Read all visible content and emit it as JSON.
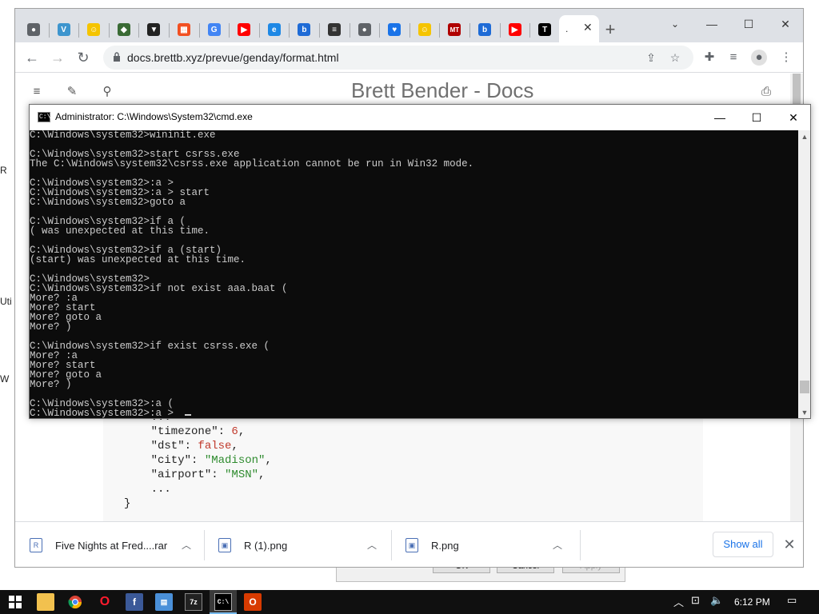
{
  "chrome": {
    "tabs": [
      {
        "icon": "globe-icon",
        "glyph": "●",
        "color": "#5f6368"
      },
      {
        "icon": "venmo-icon",
        "glyph": "V",
        "color": "#3d95ce"
      },
      {
        "icon": "smiley-icon",
        "glyph": "☺",
        "color": "#f5c400"
      },
      {
        "icon": "shield-green-icon",
        "glyph": "◆",
        "color": "#3a6b35"
      },
      {
        "icon": "shield-icon",
        "glyph": "▼",
        "color": "#222222"
      },
      {
        "icon": "microsoft-icon",
        "glyph": "▦",
        "color": "#f25022"
      },
      {
        "icon": "google-icon",
        "glyph": "G",
        "color": "#4285f4"
      },
      {
        "icon": "youtube-icon",
        "glyph": "▶",
        "color": "#ff0000"
      },
      {
        "icon": "edge-icon",
        "glyph": "e",
        "color": "#1e88e5"
      },
      {
        "icon": "bing-icon",
        "glyph": "b",
        "color": "#1e6bd6"
      },
      {
        "icon": "library-icon",
        "glyph": "≡",
        "color": "#333333"
      },
      {
        "icon": "globe-icon",
        "glyph": "●",
        "color": "#5f6368"
      },
      {
        "icon": "heart-icon",
        "glyph": "♥",
        "color": "#1a73e8"
      },
      {
        "icon": "smiley-icon",
        "glyph": "☺",
        "color": "#f5c400"
      },
      {
        "icon": "mt-icon",
        "glyph": "MT",
        "color": "#b00000"
      },
      {
        "icon": "bing-icon",
        "glyph": "b",
        "color": "#1e6bd6"
      },
      {
        "icon": "youtube-icon",
        "glyph": "▶",
        "color": "#ff0000"
      },
      {
        "icon": "t-icon",
        "glyph": "T",
        "color": "#000000"
      }
    ],
    "active_tab_title": ".",
    "url": "docs.brettb.xyz/prevue/genday/format.html"
  },
  "page": {
    "title": "Brett Bender - Docs",
    "code_lines": [
      {
        "indent": "    ",
        "text": "..."
      },
      {
        "indent": "    ",
        "key": "\"timezone\": ",
        "value": "6",
        "vtype": "num",
        "tail": ","
      },
      {
        "indent": "    ",
        "key": "\"dst\": ",
        "value": "false",
        "vtype": "bool",
        "tail": ","
      },
      {
        "indent": "    ",
        "key": "\"city\": ",
        "value": "\"Madison\"",
        "vtype": "str",
        "tail": ","
      },
      {
        "indent": "    ",
        "key": "\"airport\": ",
        "value": "\"MSN\"",
        "vtype": "str",
        "tail": ","
      },
      {
        "indent": "    ",
        "text": "..."
      },
      {
        "indent": "",
        "text": "}"
      }
    ]
  },
  "downloads": {
    "items": [
      {
        "name": "Five Nights at Fred....rar",
        "icon": "rar-icon"
      },
      {
        "name": "R (1).png",
        "icon": "image-file-icon"
      },
      {
        "name": "R.png",
        "icon": "image-file-icon"
      }
    ],
    "show_all": "Show all"
  },
  "cmd": {
    "title": "Administrator: C:\\Windows\\System32\\cmd.exe",
    "lines": [
      "C:\\Windows\\system32>wininit.exe",
      "",
      "C:\\Windows\\system32>start csrss.exe",
      "The C:\\Windows\\system32\\csrss.exe application cannot be run in Win32 mode.",
      "",
      "C:\\Windows\\system32>:a >",
      "C:\\Windows\\system32>:a > start",
      "C:\\Windows\\system32>goto a",
      "",
      "C:\\Windows\\system32>if a (",
      "( was unexpected at this time.",
      "",
      "C:\\Windows\\system32>if a (start)",
      "(start) was unexpected at this time.",
      "",
      "C:\\Windows\\system32>",
      "C:\\Windows\\system32>if not exist aaa.baat (",
      "More? :a",
      "More? start",
      "More? goto a",
      "More? )",
      "",
      "C:\\Windows\\system32>if exist csrss.exe (",
      "More? :a",
      "More? start",
      "More? goto a",
      "More? )",
      "",
      "C:\\Windows\\system32>:a (",
      "C:\\Windows\\system32>:a >"
    ]
  },
  "behind_dialog": {
    "buttons": [
      "OK",
      "Cancel",
      "Apply"
    ]
  },
  "desktop_edge_text": [
    "R",
    "Uti",
    "W"
  ],
  "taskbar": {
    "time": "6:12 PM"
  }
}
